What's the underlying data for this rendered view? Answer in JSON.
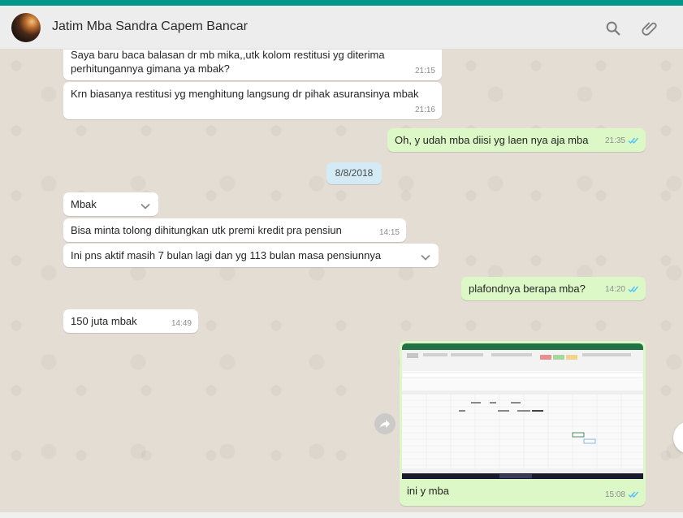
{
  "header": {
    "contact_name": "Jatim Mba Sandra Capem Bancar"
  },
  "icons": {
    "search": "search-icon",
    "attach": "paperclip-icon"
  },
  "colors": {
    "accent": "#009688",
    "incoming": "#ffffff",
    "outgoing": "#dcf8c6",
    "read_ticks": "#4fc3f7"
  },
  "messages": [
    {
      "text": "Saya baru baca balasan dr mb mika,,utk kolom restitusi yg diterima perhitungannya gimana ya mbak?",
      "time": "21:15"
    },
    {
      "text": "Krn biasanya restitusi yg menghitung langsung dr pihak asuransinya mbak",
      "time": "21:16"
    },
    {
      "text": "Oh, y udah mba diisi yg laen nya aja mba",
      "time": "21:35"
    },
    {
      "text": "Mbak",
      "time": ""
    },
    {
      "text": "Bisa minta tolong dihitungkan utk premi kredit pra pensiun",
      "time": "14:15"
    },
    {
      "text": "Ini pns aktif masih 7 bulan lagi dan yg 113 bulan masa pensiunnya",
      "time": ""
    },
    {
      "text": "plafondnya berapa mba?",
      "time": "14:20"
    },
    {
      "text": "150 juta mbak",
      "time": "14:49"
    },
    {
      "text": "ini y mba",
      "time": "15:08"
    }
  ],
  "date_divider": "8/8/2018"
}
